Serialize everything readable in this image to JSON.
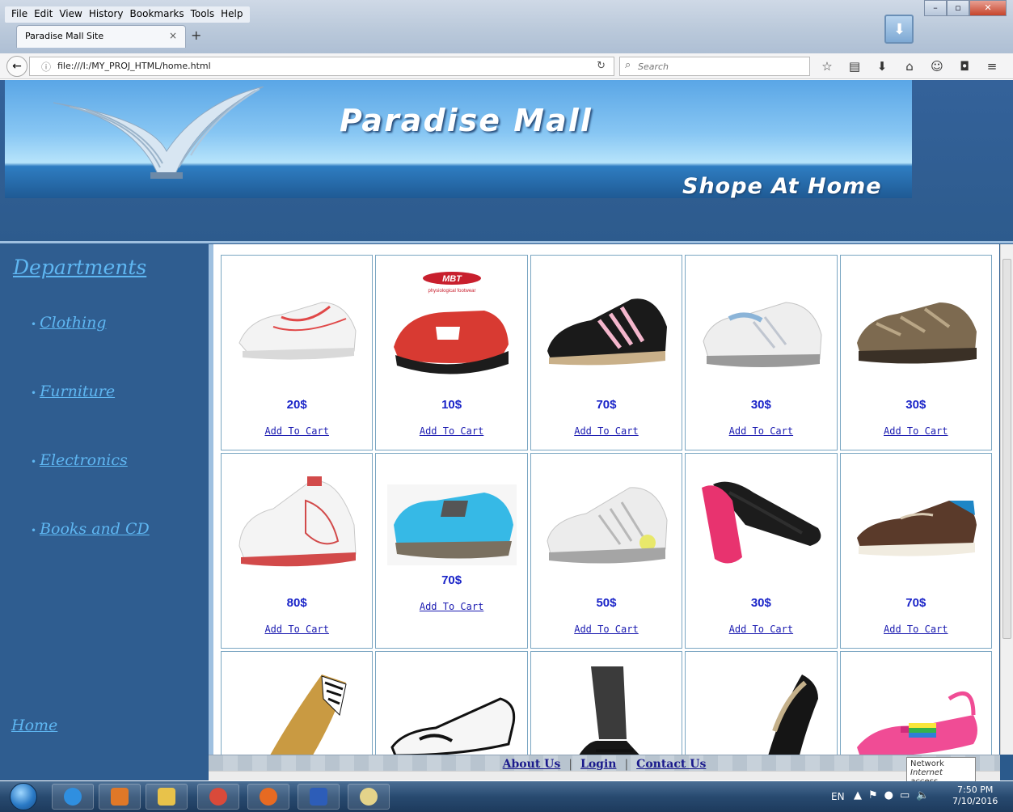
{
  "menubar": {
    "items": [
      "File",
      "Edit",
      "View",
      "History",
      "Bookmarks",
      "Tools",
      "Help"
    ]
  },
  "tab": {
    "title": "Paradise Mall Site",
    "close": "×",
    "new": "+"
  },
  "nav": {
    "url": "file:///I:/MY_PROJ_HTML/home.html",
    "search_placeholder": "Search"
  },
  "toolbar_icons": [
    "star-icon",
    "reading-list-icon",
    "download-icon",
    "home-icon",
    "chat-icon",
    "pocket-icon",
    "menu-icon"
  ],
  "banner": {
    "title": "Paradise Mall",
    "subtitle": "Shope At Home"
  },
  "sidebar": {
    "heading": "Departments",
    "items": [
      "Clothing",
      "Furniture",
      "Electronics",
      "Books and CD"
    ],
    "home": "Home"
  },
  "products": [
    {
      "price": "20$",
      "cart": "Add To Cart",
      "icon": "white-red-sneaker"
    },
    {
      "price": "10$",
      "cart": "Add To Cart",
      "icon": "red-mbt-shoe",
      "logo": "MBT",
      "logo_sub": "physiological footwear"
    },
    {
      "price": "70$",
      "cart": "Add To Cart",
      "icon": "black-pink-sneaker"
    },
    {
      "price": "30$",
      "cart": "Add To Cart",
      "icon": "white-blue-sneaker"
    },
    {
      "price": "30$",
      "cart": "Add To Cart",
      "icon": "brown-hiking-shoe"
    },
    {
      "price": "80$",
      "cart": "Add To Cart",
      "icon": "white-skate-shoe"
    },
    {
      "price": "70$",
      "cart": "Add To Cart",
      "icon": "blue-water-shoe"
    },
    {
      "price": "50$",
      "cart": "Add To Cart",
      "icon": "white-running-shoe"
    },
    {
      "price": "30$",
      "cart": "Add To Cart",
      "icon": "pink-black-slipper"
    },
    {
      "price": "70$",
      "cart": "Add To Cart",
      "icon": "brown-boat-shoe"
    },
    {
      "icon": "striped-heel"
    },
    {
      "icon": "white-loafer"
    },
    {
      "icon": "black-mary-jane"
    },
    {
      "icon": "black-pump"
    },
    {
      "icon": "pink-flat-sandal"
    }
  ],
  "footer": {
    "links": [
      "About Us",
      "Login",
      "Contact Us"
    ],
    "separator": "|"
  },
  "network_tip": {
    "line1": "Network",
    "line2": "Internet access"
  },
  "tray": {
    "lang": "EN",
    "time": "7:50 PM",
    "date": "7/10/2016"
  },
  "colors": {
    "page_bg": "#2b5a8c",
    "link": "#5fb7f2",
    "price": "#1a24c8"
  }
}
